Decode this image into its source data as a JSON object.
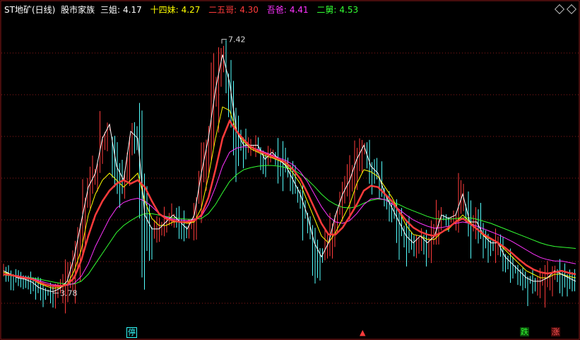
{
  "header": {
    "stock_name": "ST地矿(日线)",
    "indicator_name": "股市家族",
    "series_labels": [
      {
        "label": "三姐:",
        "value": "4.17",
        "color": "#ffffff"
      },
      {
        "label": "十四妹:",
        "value": "4.27",
        "color": "#ffff00"
      },
      {
        "label": "二五哥:",
        "value": "4.30",
        "color": "#ff3b3b"
      },
      {
        "label": "吾爸:",
        "value": "4.41",
        "color": "#ff33ff"
      },
      {
        "label": "二舅:",
        "value": "4.53",
        "color": "#33ff33"
      }
    ]
  },
  "annotations": {
    "high_label": "7.42",
    "low_label": "3.78"
  },
  "markers": [
    {
      "text": "停",
      "color": "#33ffff"
    },
    {
      "text": "跌",
      "color": "#33ff33"
    },
    {
      "text": "涨",
      "color": "#ff5555"
    }
  ],
  "colors": {
    "background": "#000000",
    "grid": "#8b1a1a",
    "up": "#ff3b3b",
    "down": "#54ffff"
  },
  "chart_data": {
    "type": "line",
    "x": [
      0,
      10,
      20,
      30,
      40,
      50,
      60,
      70,
      80,
      90,
      100,
      110,
      120,
      130,
      140,
      150,
      160,
      170,
      180,
      190,
      200,
      210,
      220,
      230,
      240,
      250,
      260,
      270,
      280,
      290,
      300,
      310,
      320,
      330,
      340,
      350,
      360,
      370,
      380,
      390,
      400,
      410,
      420,
      430,
      440,
      450,
      460,
      470,
      480,
      490,
      500,
      510,
      520,
      530,
      540,
      550,
      560,
      570,
      580,
      590,
      600,
      610,
      620,
      630,
      640,
      650,
      660,
      670,
      680,
      690,
      700,
      710,
      720,
      730,
      740,
      750,
      760,
      770,
      780,
      790,
      800,
      810
    ],
    "ylim": [
      3.3,
      7.7
    ],
    "series": [
      {
        "color": "#ffffff",
        "values": [
          4.1,
          4.05,
          4.0,
          3.98,
          3.94,
          3.86,
          3.82,
          3.8,
          3.85,
          3.95,
          4.3,
          4.8,
          5.3,
          5.5,
          6.0,
          6.2,
          5.6,
          5.4,
          6.1,
          6.0,
          4.9,
          4.7,
          4.7,
          4.8,
          4.9,
          4.8,
          4.7,
          4.9,
          5.5,
          6.0,
          6.7,
          7.2,
          6.8,
          6.1,
          5.9,
          5.9,
          5.9,
          5.7,
          5.8,
          5.7,
          5.6,
          5.4,
          5.2,
          4.9,
          4.5,
          4.3,
          4.5,
          4.9,
          5.2,
          5.4,
          5.7,
          5.9,
          5.6,
          5.5,
          5.2,
          5.0,
          4.8,
          4.6,
          4.5,
          4.6,
          4.5,
          4.6,
          4.9,
          4.85,
          4.9,
          5.2,
          4.8,
          4.8,
          4.6,
          4.5,
          4.5,
          4.3,
          4.2,
          4.1,
          4.0,
          3.95,
          3.95,
          4.0,
          4.1,
          4.05,
          4.0,
          3.95
        ]
      },
      {
        "color": "#ffff00",
        "values": [
          4.08,
          4.05,
          4.02,
          4.0,
          3.98,
          3.92,
          3.88,
          3.85,
          3.86,
          3.9,
          4.1,
          4.4,
          4.9,
          5.2,
          5.4,
          5.5,
          5.4,
          5.3,
          5.4,
          5.5,
          5.1,
          4.85,
          4.75,
          4.75,
          4.8,
          4.8,
          4.78,
          4.8,
          5.0,
          5.45,
          6.0,
          6.45,
          6.4,
          6.1,
          5.95,
          5.85,
          5.8,
          5.75,
          5.72,
          5.68,
          5.62,
          5.5,
          5.35,
          5.1,
          4.85,
          4.6,
          4.5,
          4.65,
          4.85,
          5.05,
          5.35,
          5.55,
          5.52,
          5.45,
          5.3,
          5.15,
          4.95,
          4.75,
          4.62,
          4.6,
          4.55,
          4.55,
          4.65,
          4.7,
          4.8,
          4.9,
          4.8,
          4.7,
          4.6,
          4.55,
          4.5,
          4.4,
          4.3,
          4.2,
          4.1,
          4.05,
          4.0,
          4.0,
          4.05,
          4.05,
          4.02,
          4.0
        ]
      },
      {
        "color": "#ff3b3b",
        "values": [
          4.05,
          4.04,
          4.02,
          4.0,
          3.98,
          3.94,
          3.9,
          3.88,
          3.88,
          3.9,
          4.0,
          4.25,
          4.6,
          4.9,
          5.1,
          5.25,
          5.35,
          5.4,
          5.35,
          5.4,
          5.3,
          5.1,
          4.92,
          4.85,
          4.82,
          4.8,
          4.8,
          4.82,
          4.9,
          5.15,
          5.55,
          6.0,
          6.25,
          6.1,
          5.98,
          5.88,
          5.82,
          5.78,
          5.74,
          5.7,
          5.65,
          5.55,
          5.42,
          5.22,
          5.0,
          4.78,
          4.62,
          4.62,
          4.72,
          4.88,
          5.05,
          5.25,
          5.32,
          5.3,
          5.2,
          5.1,
          4.95,
          4.82,
          4.72,
          4.66,
          4.62,
          4.6,
          4.65,
          4.72,
          4.8,
          4.85,
          4.78,
          4.7,
          4.62,
          4.56,
          4.5,
          4.43,
          4.35,
          4.26,
          4.18,
          4.12,
          4.08,
          4.06,
          4.08,
          4.1,
          4.07,
          4.05
        ]
      },
      {
        "color": "#ff33ff",
        "values": [
          4.05,
          4.04,
          4.03,
          4.01,
          3.99,
          3.96,
          3.93,
          3.9,
          3.89,
          3.89,
          3.92,
          4.02,
          4.2,
          4.45,
          4.65,
          4.85,
          5.0,
          5.08,
          5.12,
          5.14,
          5.1,
          5.02,
          4.92,
          4.87,
          4.84,
          4.83,
          4.82,
          4.84,
          4.88,
          5.05,
          5.3,
          5.6,
          5.8,
          5.86,
          5.88,
          5.87,
          5.84,
          5.8,
          5.76,
          5.72,
          5.68,
          5.62,
          5.52,
          5.38,
          5.2,
          5.02,
          4.88,
          4.8,
          4.78,
          4.82,
          4.92,
          5.05,
          5.13,
          5.14,
          5.12,
          5.06,
          4.98,
          4.9,
          4.83,
          4.78,
          4.74,
          4.71,
          4.72,
          4.74,
          4.78,
          4.8,
          4.78,
          4.74,
          4.7,
          4.66,
          4.62,
          4.57,
          4.52,
          4.46,
          4.4,
          4.34,
          4.29,
          4.26,
          4.24,
          4.24,
          4.22,
          4.2
        ]
      },
      {
        "color": "#33ff33",
        "values": [
          4.04,
          4.03,
          4.02,
          4.01,
          4.0,
          3.98,
          3.96,
          3.94,
          3.92,
          3.91,
          3.91,
          3.95,
          4.05,
          4.2,
          4.35,
          4.5,
          4.65,
          4.75,
          4.82,
          4.88,
          4.92,
          4.92,
          4.9,
          4.88,
          4.86,
          4.85,
          4.84,
          4.84,
          4.85,
          4.92,
          5.05,
          5.22,
          5.38,
          5.48,
          5.55,
          5.58,
          5.6,
          5.61,
          5.61,
          5.6,
          5.58,
          5.55,
          5.49,
          5.41,
          5.31,
          5.2,
          5.11,
          5.05,
          5.01,
          5.0,
          5.02,
          5.07,
          5.11,
          5.13,
          5.12,
          5.09,
          5.05,
          5.0,
          4.96,
          4.92,
          4.88,
          4.85,
          4.84,
          4.84,
          4.85,
          4.86,
          4.86,
          4.84,
          4.81,
          4.78,
          4.74,
          4.7,
          4.66,
          4.62,
          4.58,
          4.54,
          4.5,
          4.47,
          4.45,
          4.44,
          4.43,
          4.42
        ]
      }
    ]
  }
}
